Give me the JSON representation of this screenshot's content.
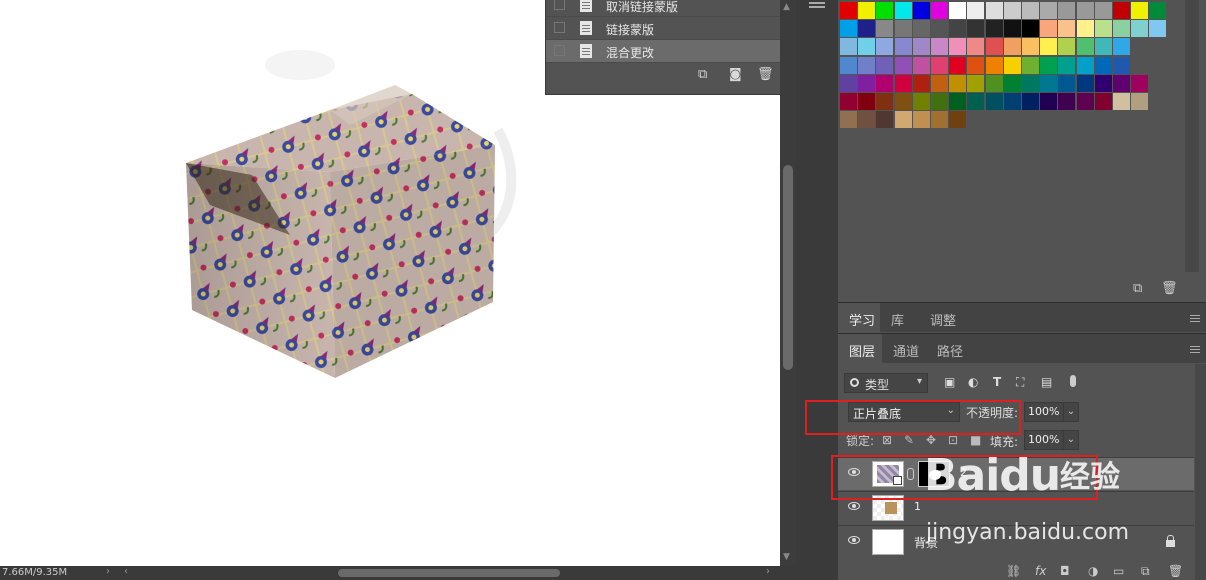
{
  "status": {
    "doc_size": "7.66M/9.35M"
  },
  "history": {
    "items": [
      {
        "label": "取消链接蒙版",
        "selected": false
      },
      {
        "label": "链接蒙版",
        "selected": false
      },
      {
        "label": "混合更改",
        "selected": true
      }
    ],
    "footer_icons": [
      "new-snapshot-icon",
      "camera-icon",
      "trash-icon"
    ]
  },
  "swatches": {
    "rows": [
      [
        "#e00000",
        "#f0f000",
        "#00e000",
        "#00e8e8",
        "#0000e0",
        "#e000e0",
        "#ffffff",
        "#eeeeee",
        "#dddddd",
        "#cccccc",
        "#bbbbbb",
        "#aaaaaa",
        "#999999",
        "#999999",
        "#999999",
        "#c00000",
        "#f0f000",
        "#008a3a"
      ],
      [
        "#00a0e8",
        "#20208a",
        "#888888",
        "#777777",
        "#666666",
        "#555555",
        "#444444",
        "#333333",
        "#222222",
        "#111111",
        "#000000",
        "#f9a67c",
        "#f9c28c",
        "#fff08a",
        "#b9e08a",
        "#8ad0a0",
        "#80d0d0",
        "#80c8f0"
      ],
      [
        "#80b8e0",
        "#70d0e8",
        "#90a8e0",
        "#8888d0",
        "#a088c8",
        "#c888c8",
        "#f090b8",
        "#f08888",
        "#e05050",
        "#f0a060",
        "#f8c060",
        "#fff050",
        "#b0d050",
        "#50c070",
        "#40b8b8",
        "#30a8e8"
      ],
      [
        "#5088d0",
        "#7080c8",
        "#7060b8",
        "#9050b8",
        "#c050a0",
        "#e04070",
        "#e00020",
        "#e05010",
        "#f08000",
        "#f8d000",
        "#70b030",
        "#00a050",
        "#00a090",
        "#00a0c8",
        "#0068b8",
        "#2058b0"
      ],
      [
        "#6040a0",
        "#8020a0",
        "#b00070",
        "#d00040",
        "#b02010",
        "#c06010",
        "#c09000",
        "#a0a000",
        "#509020",
        "#008030",
        "#007860",
        "#007890",
        "#005890",
        "#003880",
        "#300070",
        "#600070",
        "#a00060"
      ],
      [
        "#900030",
        "#800010",
        "#803010",
        "#805010",
        "#708000",
        "#407010",
        "#006020",
        "#006050",
        "#005060",
        "#004070",
        "#002060",
        "#200050",
        "#400050",
        "#600050",
        "#800030",
        "#d0c0a0",
        "#b0a080"
      ],
      [
        "#907050",
        "#705040",
        "#503830",
        "#d0a870",
        "#c09050",
        "#a07030",
        "#704010"
      ]
    ],
    "footer_icons": [
      "new-swatch-icon",
      "trash-icon"
    ]
  },
  "tabs_top": [
    {
      "label": "学习",
      "active": true
    },
    {
      "label": "库",
      "active": false
    },
    {
      "label": "调整",
      "active": false
    }
  ],
  "tabs_layers": [
    {
      "label": "图层",
      "active": true
    },
    {
      "label": "通道",
      "active": false
    },
    {
      "label": "路径",
      "active": false
    }
  ],
  "layers": {
    "filter": {
      "label": "类型",
      "icons": [
        "image-filter-icon",
        "adjustment-filter-icon",
        "type-filter-icon",
        "shape-filter-icon",
        "smart-object-filter-icon"
      ]
    },
    "blend_mode": "正片叠底",
    "opacity_label": "不透明度:",
    "opacity_value": "100%",
    "lock_label": "锁定:",
    "fill_label": "填充:",
    "fill_value": "100%",
    "rows": [
      {
        "name": "2",
        "selected": true
      },
      {
        "name": "1",
        "selected": false
      },
      {
        "name": "背景",
        "selected": false
      }
    ],
    "footer_icons": [
      "link-layers-icon",
      "fx-icon",
      "add-mask-icon",
      "adjustment-layer-icon",
      "group-folder-icon",
      "new-layer-icon",
      "trash-icon"
    ]
  },
  "watermark": {
    "brand": "Baidu",
    "cn": "经验",
    "url": "jingyan.baidu.com"
  }
}
